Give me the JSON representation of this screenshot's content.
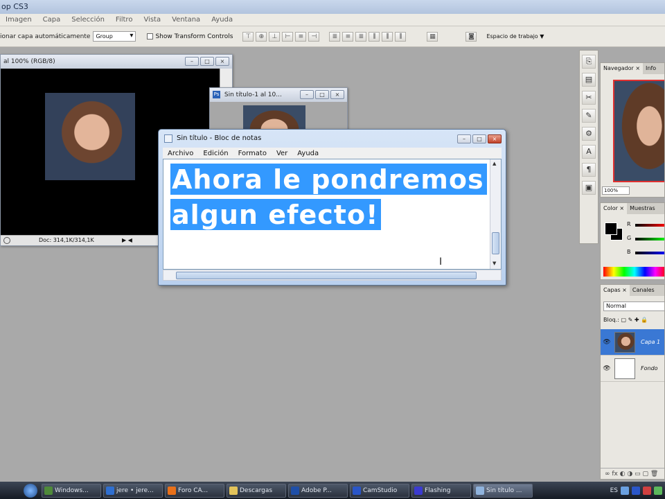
{
  "photoshop": {
    "title": "op CS3",
    "menu": [
      "Imagen",
      "Capa",
      "Selección",
      "Filtro",
      "Vista",
      "Ventana",
      "Ayuda"
    ],
    "options": {
      "auto_select_label": "ionar capa automáticamente",
      "auto_select_value": "Group",
      "transform_label": "Show Transform Controls",
      "workspace_label": "Espacio de trabajo ▼"
    },
    "doc1": {
      "title": "al 100% (RGB/8)",
      "status": "Doc: 314,1K/314,1K"
    },
    "doc2": {
      "title": "Sin título-1 al 10..."
    },
    "panels": {
      "navigator_tabs": [
        "Navegador ×",
        "Info"
      ],
      "navigator_zoom": "100%",
      "color_tabs": [
        "Color ×",
        "Muestras"
      ],
      "color_channels": [
        "R",
        "G",
        "B"
      ],
      "color_values": [
        "0",
        "0",
        "0"
      ],
      "layers_tabs": [
        "Capas ×",
        "Canales"
      ],
      "blend_mode": "Normal",
      "lock_label": "Bloq.:",
      "layers": [
        {
          "name": "Capa 1",
          "selected": true
        },
        {
          "name": "Fondo",
          "selected": false
        }
      ]
    }
  },
  "notepad": {
    "title": "Sin título - Bloc de notas",
    "menu": [
      "Archivo",
      "Edición",
      "Formato",
      "Ver",
      "Ayuda"
    ],
    "text_line1": "Ahora le pondremos",
    "text_line2": "algun efecto!"
  },
  "taskbar": {
    "items": [
      {
        "label": "Windows...",
        "color": "#4f8a3a"
      },
      {
        "label": "jere • jere...",
        "color": "#2f6fd0"
      },
      {
        "label": "Foro CA...",
        "color": "#e8701a"
      },
      {
        "label": "Descargas",
        "color": "#e3c35a"
      },
      {
        "label": "Adobe P...",
        "color": "#1f4fa8"
      },
      {
        "label": "CamStudio",
        "color": "#2a56c8"
      },
      {
        "label": "Flashing",
        "color": "#3b3bd0"
      },
      {
        "label": "Sin título ...",
        "color": "#8fb3dd"
      }
    ],
    "language": "ES"
  }
}
